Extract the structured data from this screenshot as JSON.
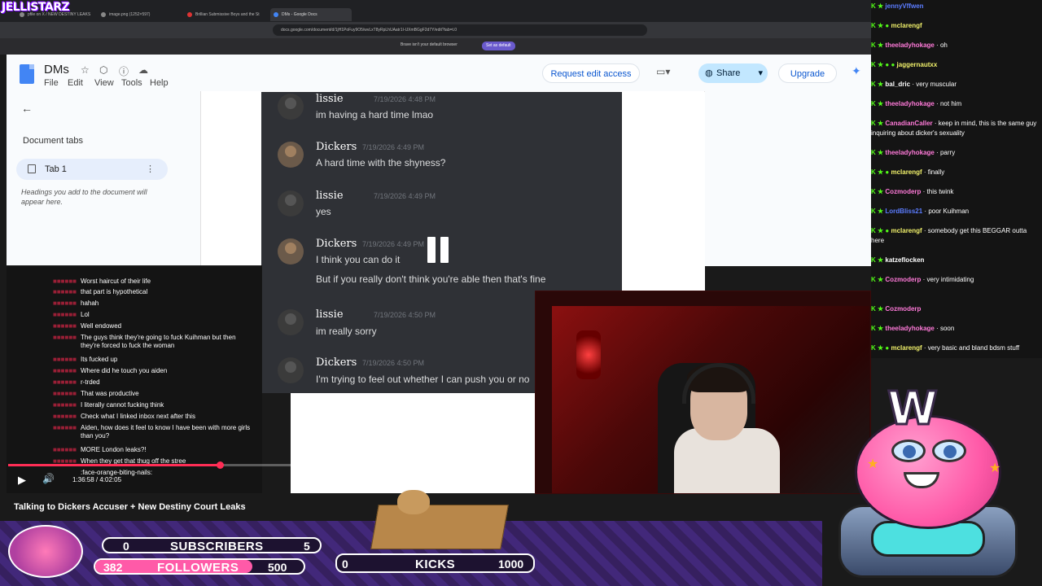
{
  "streamer": {
    "logo_text": "JELLISTARZ"
  },
  "browser": {
    "tabs": [
      "pfile on X / NEW DESTINY LEAKS",
      "image.png (1252×597)",
      "Brillian Submissive Boys and the St",
      "DMs - Google Docs"
    ],
    "url": "docs.google.com/document/d/1jH1PoFuy9O5/wvLxT8yRpLhUAatr1I-UXmBGgF2d7Y/edit?tab=t.0",
    "brave_message": "Brave isn't your default browser",
    "brave_button": "Set as default"
  },
  "docs": {
    "title": "DMs",
    "menu": [
      "File",
      "Edit",
      "View",
      "Tools",
      "Help"
    ],
    "request_edit": "Request edit access",
    "share": "Share",
    "upgrade": "Upgrade",
    "document_tabs_title": "Document tabs",
    "tab1": "Tab 1",
    "hint": "Headings you add to the document will appear here."
  },
  "dm": {
    "messages": [
      {
        "user": "lissie",
        "time": "7/19/2026 4:48 PM",
        "lines": [
          "im having a hard time lmao"
        ]
      },
      {
        "user": "Dickers",
        "time": "7/19/2026 4:49 PM",
        "lines": [
          "A hard time with the shyness?"
        ]
      },
      {
        "user": "lissie",
        "time": "7/19/2026 4:49 PM",
        "lines": [
          "yes"
        ]
      },
      {
        "user": "Dickers",
        "time": "7/19/2026 4:49 PM",
        "lines": [
          "I think you can do it",
          "But if you really don't think you're able then that's fine"
        ]
      },
      {
        "user": "lissie",
        "time": "7/19/2026 4:50 PM",
        "lines": [
          "im really sorry"
        ]
      },
      {
        "user": "Dickers",
        "time": "7/19/2026 4:50 PM",
        "lines": [
          "I'm trying to feel out whether I can push you or no"
        ]
      }
    ]
  },
  "left_chat": [
    "Worst haircut of their life",
    "that part is hypothetical",
    "hahah",
    "Lol",
    "Well endowed",
    "The guys think they're going to fuck Kuihman but then they're forced to fuck the woman",
    "Its fucked up",
    "Where did he touch you aiden",
    "r-trded",
    "That was productive",
    "I literally cannot fucking think",
    "Check what I linked inbox next after this",
    "Aiden, how does it feel to know I have been with more girls than you?",
    "MORE London leaks?!",
    "When they get that thug off the stree",
    ":face-orange-biting-nails:"
  ],
  "player": {
    "time": "1:36:58 / 4:02:05",
    "progress": 0.4,
    "title": "Talking to Dickers Accuser + New Destiny Court Leaks"
  },
  "right_chat": [
    {
      "user": "jennyVffwen",
      "text": ""
    },
    {
      "user": "mclarengf",
      "text": ""
    },
    {
      "user": "theeladyhokage",
      "text": "oh"
    },
    {
      "user": "jaggernautxx",
      "text": ""
    },
    {
      "user": "bal_dric",
      "text": "very muscular"
    },
    {
      "user": "theeladyhokage",
      "text": "not him"
    },
    {
      "user": "CanadianCaller",
      "text": "keep in mind, this is the same guy inquiring about dicker's sexuality"
    },
    {
      "user": "theeladyhokage",
      "text": "parry"
    },
    {
      "user": "mclarengf",
      "text": "finally"
    },
    {
      "user": "Cozmoderp",
      "text": "this twink"
    },
    {
      "user": "LordBliss21",
      "text": "poor Kuihman"
    },
    {
      "user": "mclarengf",
      "text": "somebody get this BEGGAR outta here"
    },
    {
      "user": "katzeflocken",
      "text": ""
    },
    {
      "user": "Cozmoderp",
      "text": "very intimidating"
    },
    {
      "user": "Cozmoderp",
      "text": ""
    },
    {
      "user": "theeladyhokage",
      "text": "soon"
    },
    {
      "user": "mclarengf",
      "text": "very basic and bland bdsm stuff"
    }
  ],
  "overlay": {
    "subs_current": "0",
    "subs_label": "SUBSCRIBERS",
    "subs_goal": "5",
    "followers_current": "382",
    "followers_label": "FOLLOWERS",
    "followers_goal": "500",
    "kicks_current": "0",
    "kicks_label": "KICKS",
    "kicks_goal": "1000"
  }
}
